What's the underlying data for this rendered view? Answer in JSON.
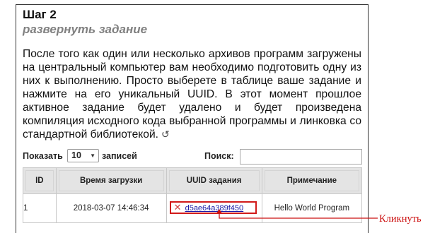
{
  "step": {
    "title": "Шаг 2",
    "subtitle": "развернуть задание",
    "description": "После того как один или несколько архивов программ загружены на центральный компьютер вам необходимо подготовить одну из них к выполнению. Просто выберете в таблице ваше задание и нажмите на его уникальный UUID. В этот момент прошлое активное задание будет удалено и будет произведена компиляция исходного кода выбранной программы и линковка со стандартной библиотекой.",
    "refresh_icon": "refresh-icon",
    "refresh_glyph": "↺"
  },
  "table_controls": {
    "show_label": "Показать",
    "page_length": "10",
    "records_label": "записей",
    "search_label": "Поиск:",
    "search_value": ""
  },
  "table": {
    "columns": [
      "ID",
      "Время загрузки",
      "UUID задания",
      "Примечание"
    ],
    "rows": [
      {
        "id": "1",
        "upload_time": "2018-03-07 14:46:34",
        "uuid": "d5ae64a389f450",
        "note": "Hello World Program",
        "delete_icon": "close-icon",
        "delete_glyph": "✕"
      }
    ]
  },
  "annotation": {
    "label": "Кликнуть",
    "color": "#cc1111"
  }
}
